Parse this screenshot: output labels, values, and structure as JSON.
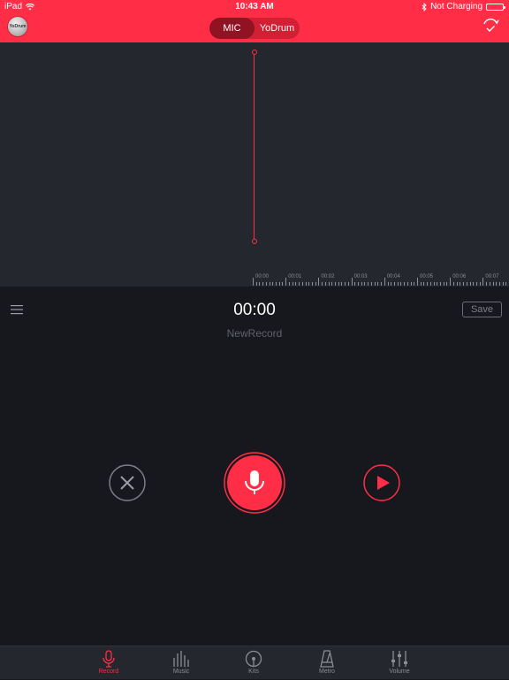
{
  "status_bar": {
    "device": "iPad",
    "time": "10:43 AM",
    "charging": "Not Charging"
  },
  "header": {
    "segments": [
      {
        "label": "MIC",
        "active": true
      },
      {
        "label": "YoDrum",
        "active": false
      }
    ],
    "icons": [
      "avatar",
      "sync-icon"
    ]
  },
  "timeline": {
    "labels": [
      "00:00",
      "00:01",
      "00:02",
      "00:03",
      "00:04",
      "00:05",
      "00:06",
      "00:07"
    ]
  },
  "recorder": {
    "timer": "00:00",
    "record_name": "NewRecord",
    "save_label": "Save"
  },
  "tabbar": {
    "items": [
      {
        "label": "Record",
        "icon": "mic-icon",
        "active": true
      },
      {
        "label": "Music",
        "icon": "music-bars-icon",
        "active": false
      },
      {
        "label": "Kits",
        "icon": "kits-icon",
        "active": false
      },
      {
        "label": "Metro",
        "icon": "metronome-icon",
        "active": false
      },
      {
        "label": "Volume",
        "icon": "sliders-icon",
        "active": false
      }
    ]
  },
  "colors": {
    "accent": "#ff2d45",
    "segment_active": "#8f1322",
    "wave_bg": "#24272e",
    "body_bg": "#16181d"
  }
}
